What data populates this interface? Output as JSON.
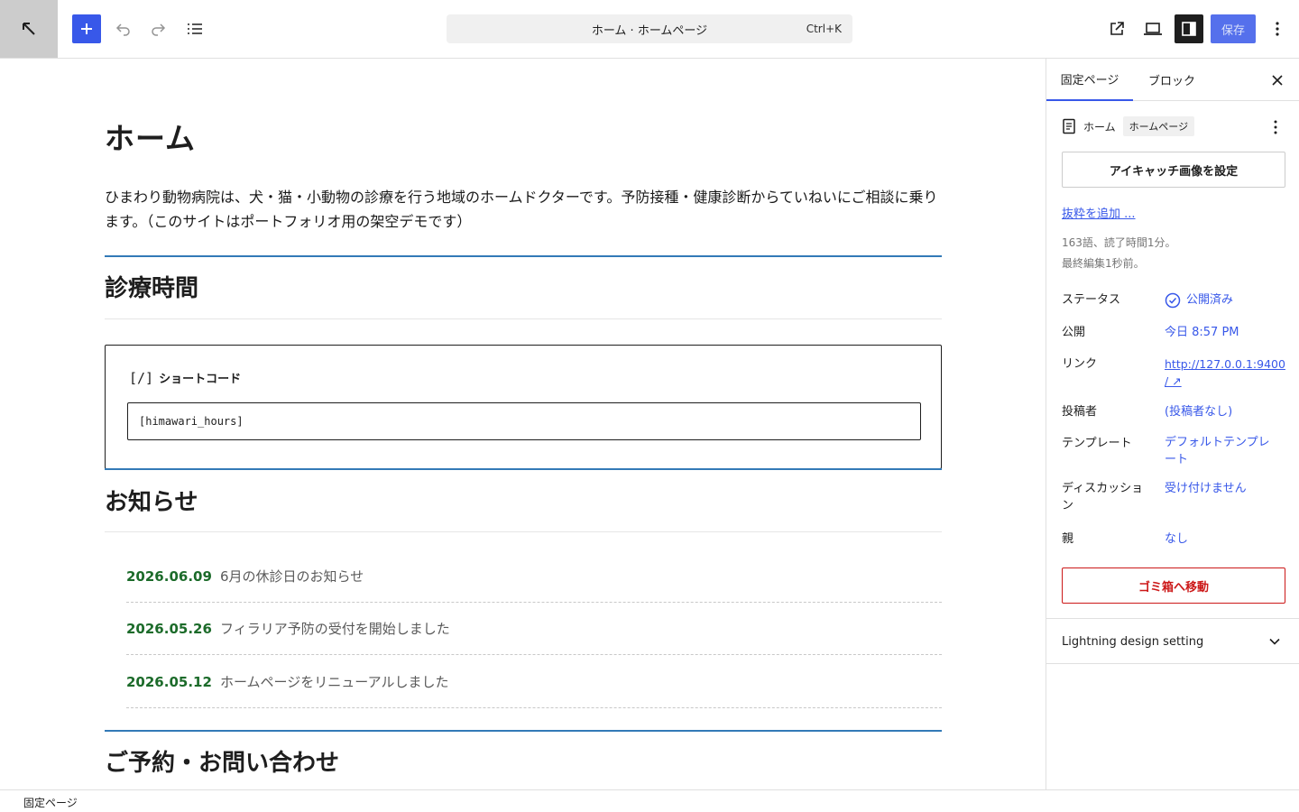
{
  "toolbar": {
    "command_title": "ホーム · ホームページ",
    "command_shortcut": "Ctrl+K",
    "save_label": "保存",
    "colors": {
      "accent": "#3858e9",
      "site_button_bg": "#cccccc"
    },
    "icons": [
      "arrow-up-left-icon",
      "plus-icon",
      "undo-icon",
      "redo-icon",
      "list-view-icon",
      "external-link-icon",
      "laptop-preview-icon",
      "sidebar-toggle-icon",
      "more-vertical-icon"
    ]
  },
  "editor": {
    "title": "ホーム",
    "intro": "ひまわり動物病院は、犬・猫・小動物の診療を行う地域のホームドクターです。予防接種・健康診断からていねいにご相談に乗ります。（このサイトはポートフォリオ用の架空デモです）",
    "hours_heading": "診療時間",
    "shortcode": {
      "label": "ショートコード",
      "icon_glyph": "[/]",
      "value": "[himawari_hours]"
    },
    "news_heading": "お知らせ",
    "news": [
      {
        "date": "2026.06.09",
        "title": "6月の休診日のお知らせ"
      },
      {
        "date": "2026.05.26",
        "title": "フィラリア予防の受付を開始しました"
      },
      {
        "date": "2026.05.12",
        "title": "ホームページをリニューアルしました"
      }
    ],
    "contact_heading": "ご予約・お問い合わせ",
    "colors": {
      "rule": "#337ab7",
      "news_date": "#1c6b2a"
    }
  },
  "sidebar": {
    "tabs": [
      {
        "label": "固定ページ",
        "active": true
      },
      {
        "label": "ブロック",
        "active": false
      }
    ],
    "page_title": "ホーム",
    "page_badge": "ホームページ",
    "featured_image_button": "アイキャッチ画像を設定",
    "excerpt_link": "抜粋を追加 ...",
    "word_count": "163語、読了時間1分。",
    "last_edited": "最終編集1秒前。",
    "rows": [
      {
        "label": "ステータス",
        "value": "公開済み"
      },
      {
        "label": "公開",
        "value": "今日 8:57 PM"
      },
      {
        "label": "リンク",
        "value": "http://127.0.0.1:9400/",
        "value_line1": "http://127.0.0.1:9400",
        "value_line2": "/ ↗"
      },
      {
        "label": "投稿者",
        "value": "(投稿者なし)"
      },
      {
        "label": "テンプレート",
        "value": "デフォルトテンプレート",
        "value_line1": "デフォルトテンプレ",
        "value_line2": "ート"
      },
      {
        "label": "ディスカッション",
        "label_line1": "ディスカッショ",
        "label_line2": "ン",
        "value": "受け付けません"
      },
      {
        "label": "親",
        "value": "なし"
      }
    ],
    "trash_button": "ゴミ箱へ移動",
    "panel_title": "Lightning design setting",
    "colors": {
      "danger": "#cc1818",
      "link": "#3858e9"
    }
  },
  "footer": {
    "breadcrumb": "固定ページ"
  }
}
